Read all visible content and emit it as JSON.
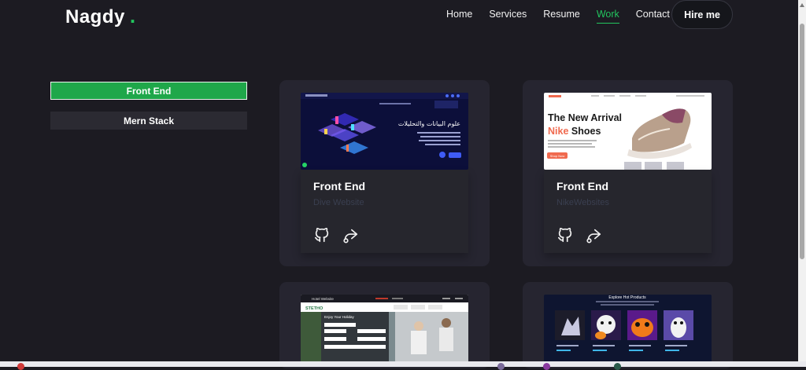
{
  "brand": {
    "name": "Nagdy",
    "dot": "."
  },
  "nav": {
    "items": [
      {
        "label": "Home",
        "active": false
      },
      {
        "label": "Services",
        "active": false
      },
      {
        "label": "Resume",
        "active": false
      },
      {
        "label": "Work",
        "active": true
      },
      {
        "label": "Contact",
        "active": false
      }
    ],
    "cta": "Hire me"
  },
  "filters": [
    {
      "label": "Front End",
      "active": true
    },
    {
      "label": "Mern Stack",
      "active": false
    }
  ],
  "projects": [
    {
      "category": "Front End",
      "name": "Dive Website",
      "preview": {
        "heading_ar": "علوم البيانات والتحليلات"
      }
    },
    {
      "category": "Front End",
      "name": "NikeWebsites",
      "preview": {
        "line1": "The New Arrival",
        "line2_accent": "Nike",
        "line2_rest": " Shoes",
        "button": "Shop Now"
      }
    },
    {
      "category": "",
      "name": "",
      "preview": {
        "label": "Hotel Website",
        "brand": "STETHO",
        "form_title": "Enjoy Your Holiday"
      }
    },
    {
      "category": "",
      "name": "",
      "preview": {
        "heading": "Explore Hot Products"
      }
    }
  ],
  "icons": {
    "github": "github-icon",
    "share": "share-icon"
  },
  "colors": {
    "accent": "#22c55e",
    "background": "#1c1b22",
    "card": "#262530",
    "filter_active": "#1fa74a"
  }
}
